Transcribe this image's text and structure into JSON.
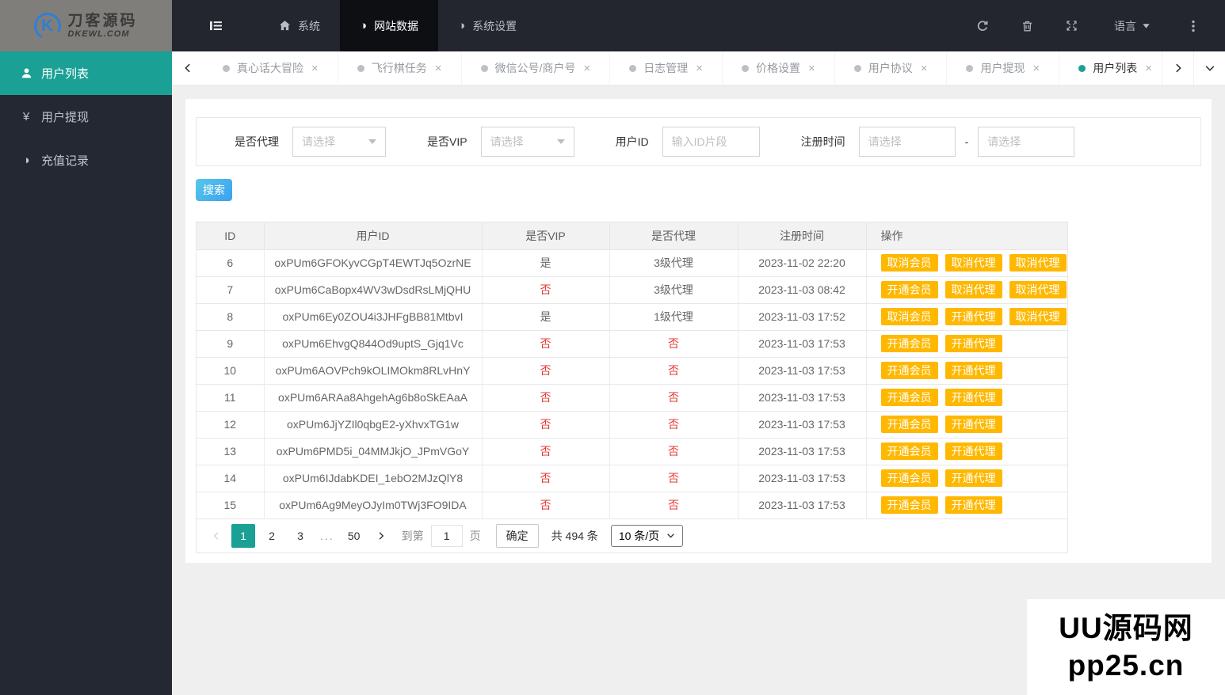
{
  "navbar": {
    "logo": {
      "line1": "刀客源码",
      "line2": "DKEWL.COM"
    },
    "menu": [
      {
        "name": "menu-collapse",
        "icon": "collapse",
        "label": ""
      },
      {
        "name": "menu-system",
        "icon": "home",
        "label": "系统"
      },
      {
        "name": "menu-site-data",
        "icon": "half",
        "label": "网站数据",
        "active": true
      },
      {
        "name": "menu-system-settings",
        "icon": "half",
        "label": "系统设置"
      }
    ],
    "right": {
      "language_label": "语言"
    }
  },
  "tabbar": {
    "close_glyph": "×",
    "tabs": [
      {
        "name": "tab-truth-or-dare",
        "label": "真心话大冒险"
      },
      {
        "name": "tab-flight-chess-task",
        "label": "飞行棋任务"
      },
      {
        "name": "tab-wechat-merchant",
        "label": "微信公号/商户号"
      },
      {
        "name": "tab-log-management",
        "label": "日志管理"
      },
      {
        "name": "tab-price-settings",
        "label": "价格设置"
      },
      {
        "name": "tab-user-agreement",
        "label": "用户协议"
      },
      {
        "name": "tab-user-withdraw",
        "label": "用户提现"
      },
      {
        "name": "tab-user-list",
        "label": "用户列表",
        "active": true
      }
    ]
  },
  "sidebar": {
    "items": [
      {
        "name": "sidebar-item-user-list",
        "icon": "user",
        "label": "用户列表",
        "active": true
      },
      {
        "name": "sidebar-item-user-withdraw",
        "icon": "yen",
        "label": "用户提现"
      },
      {
        "name": "sidebar-item-recharge-records",
        "icon": "half",
        "label": "充值记录"
      }
    ]
  },
  "filters": {
    "agent": {
      "label": "是否代理",
      "value": "请选择"
    },
    "vip": {
      "label": "是否VIP",
      "value": "请选择"
    },
    "user_id": {
      "label": "用户ID",
      "placeholder": "输入ID片段"
    },
    "reg_time": {
      "label": "注册时间",
      "start_placeholder": "请选择",
      "separator": "-",
      "end_placeholder": "请选择"
    }
  },
  "search_button": "搜索",
  "table": {
    "columns": [
      "ID",
      "用户ID",
      "是否VIP",
      "是否代理",
      "注册时间",
      "操作"
    ],
    "rows": [
      {
        "id": "6",
        "user_id": "oxPUm6GFOKyvCGpT4EWTJq5OzrNE",
        "vip": "是",
        "agent": "3级代理",
        "reg_time": "2023-11-02 22:20",
        "actions": [
          "取消会员",
          "取消代理",
          "取消代理"
        ]
      },
      {
        "id": "7",
        "user_id": "oxPUm6CaBopx4WV3wDsdRsLMjQHU",
        "vip": "否",
        "agent": "3级代理",
        "reg_time": "2023-11-03 08:42",
        "actions": [
          "开通会员",
          "取消代理",
          "取消代理"
        ]
      },
      {
        "id": "8",
        "user_id": "oxPUm6Ey0ZOU4i3JHFgBB81MtbvI",
        "vip": "是",
        "agent": "1级代理",
        "reg_time": "2023-11-03 17:52",
        "actions": [
          "取消会员",
          "开通代理",
          "取消代理"
        ]
      },
      {
        "id": "9",
        "user_id": "oxPUm6EhvgQ844Od9uptS_Gjq1Vc",
        "vip": "否",
        "agent": "否",
        "reg_time": "2023-11-03 17:53",
        "actions": [
          "开通会员",
          "开通代理"
        ]
      },
      {
        "id": "10",
        "user_id": "oxPUm6AOVPch9kOLIMOkm8RLvHnY",
        "vip": "否",
        "agent": "否",
        "reg_time": "2023-11-03 17:53",
        "actions": [
          "开通会员",
          "开通代理"
        ]
      },
      {
        "id": "11",
        "user_id": "oxPUm6ARAa8AhgehAg6b8oSkEAaA",
        "vip": "否",
        "agent": "否",
        "reg_time": "2023-11-03 17:53",
        "actions": [
          "开通会员",
          "开通代理"
        ]
      },
      {
        "id": "12",
        "user_id": "oxPUm6JjYZIl0qbgE2-yXhvxTG1w",
        "vip": "否",
        "agent": "否",
        "reg_time": "2023-11-03 17:53",
        "actions": [
          "开通会员",
          "开通代理"
        ]
      },
      {
        "id": "13",
        "user_id": "oxPUm6PMD5i_04MMJkjO_JPmVGoY",
        "vip": "否",
        "agent": "否",
        "reg_time": "2023-11-03 17:53",
        "actions": [
          "开通会员",
          "开通代理"
        ]
      },
      {
        "id": "14",
        "user_id": "oxPUm6IJdabKDEI_1ebO2MJzQlY8",
        "vip": "否",
        "agent": "否",
        "reg_time": "2023-11-03 17:53",
        "actions": [
          "开通会员",
          "开通代理"
        ]
      },
      {
        "id": "15",
        "user_id": "oxPUm6Ag9MeyOJyIm0TWj3FO9IDA",
        "vip": "否",
        "agent": "否",
        "reg_time": "2023-11-03 17:53",
        "actions": [
          "开通会员",
          "开通代理"
        ]
      }
    ]
  },
  "pagination": {
    "items": [
      {
        "label": "1",
        "active": true
      },
      {
        "label": "2"
      },
      {
        "label": "3"
      },
      {
        "label": "...",
        "ellipsis": true
      },
      {
        "label": "50"
      }
    ],
    "goto_label": "到第",
    "goto_value": "1",
    "page_word": "页",
    "confirm_label": "确定",
    "total_label": "共 494 条",
    "page_size": "10 条/页"
  },
  "watermark": {
    "line1": "UU源码网",
    "line2": "pp25.cn"
  },
  "colors": {
    "accent_teal": "#1aa094",
    "button_warn": "#ffb800",
    "navbar_bg": "#23262e",
    "status_no_red": "#e23c39",
    "search_gradient_start": "#55c9e8",
    "search_gradient_end": "#3d9ff0"
  }
}
